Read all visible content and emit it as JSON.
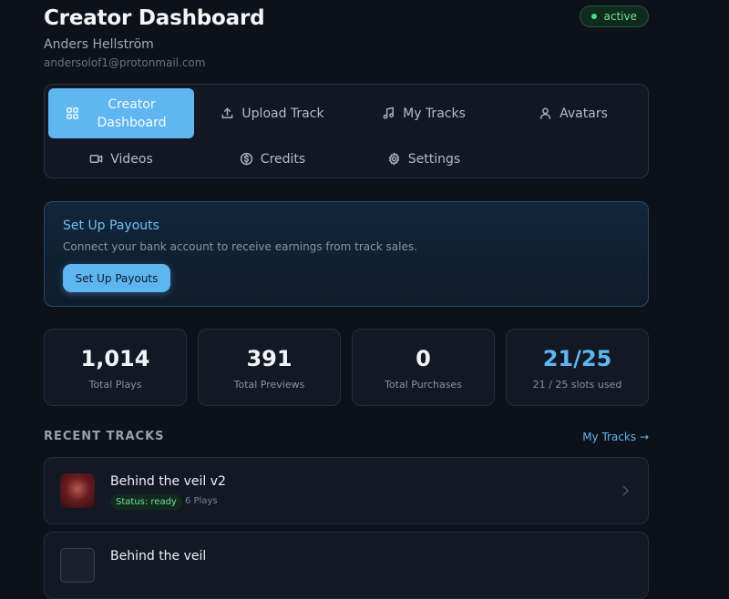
{
  "header": {
    "title": "Creator Dashboard",
    "user_name": "Anders Hellström",
    "email": "andersolof1@protonmail.com",
    "status_badge": "active"
  },
  "nav": {
    "items": [
      {
        "label": "Creator Dashboard",
        "icon": "grid-icon",
        "active": true
      },
      {
        "label": "Upload Track",
        "icon": "upload-icon"
      },
      {
        "label": "My Tracks",
        "icon": "music-note-icon"
      },
      {
        "label": "Avatars",
        "icon": "user-icon"
      },
      {
        "label": "Videos",
        "icon": "video-icon"
      },
      {
        "label": "Credits",
        "icon": "dollar-circle-icon"
      },
      {
        "label": "Settings",
        "icon": "gear-icon"
      }
    ]
  },
  "payouts": {
    "title": "Set Up Payouts",
    "description": "Connect your bank account to receive earnings from track sales.",
    "button_label": "Set Up Payouts"
  },
  "stats": [
    {
      "value": "1,014",
      "label": "Total Plays"
    },
    {
      "value": "391",
      "label": "Total Previews"
    },
    {
      "value": "0",
      "label": "Total Purchases"
    },
    {
      "value": "21/25",
      "label": "21 / 25 slots used",
      "accent": "#5fb6f0"
    }
  ],
  "recent_tracks": {
    "heading": "RECENT TRACKS",
    "link_label": "My Tracks →",
    "items": [
      {
        "title": "Behind the veil v2",
        "status": "Status: ready",
        "plays": "6 Plays"
      },
      {
        "title": "Behind the veil"
      }
    ]
  },
  "colors": {
    "accent": "#5fb6f0",
    "background": "#0d1119",
    "success": "#4ade80"
  }
}
